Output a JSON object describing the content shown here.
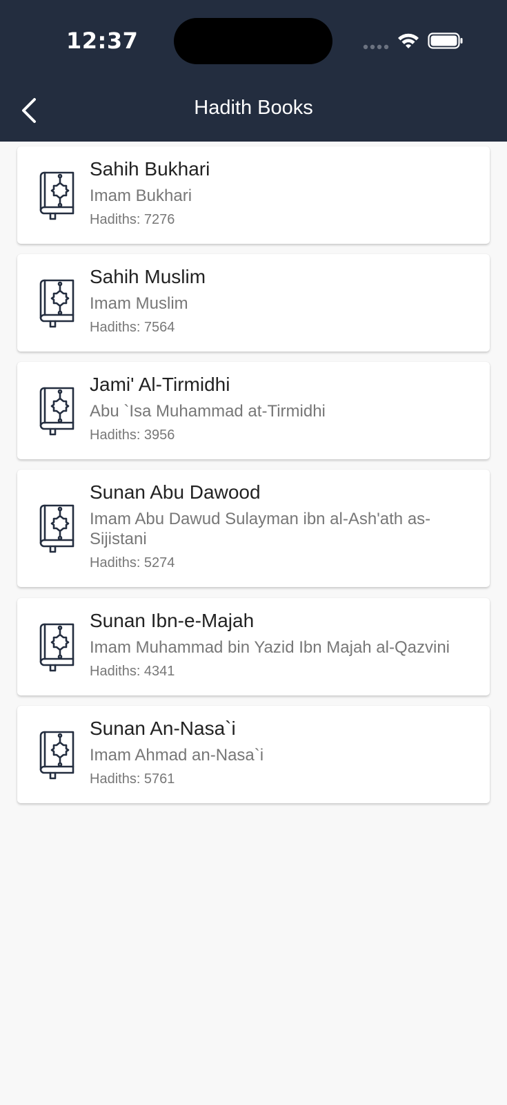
{
  "status_bar": {
    "time": "12:37"
  },
  "nav": {
    "title": "Hadith Books",
    "back_icon": "chevron-left-icon"
  },
  "colors": {
    "header_bg": "#232d3f",
    "page_bg": "#f8f8f8",
    "card_bg": "#ffffff",
    "icon": "#232d3f"
  },
  "books": [
    {
      "title": "Sahih Bukhari",
      "author": "Imam Bukhari",
      "count": "Hadiths: 7276",
      "icon": "book-icon"
    },
    {
      "title": "Sahih Muslim",
      "author": "Imam Muslim",
      "count": "Hadiths: 7564",
      "icon": "book-icon"
    },
    {
      "title": "Jami' Al-Tirmidhi",
      "author": "Abu `Isa Muhammad at-Tirmidhi",
      "count": "Hadiths: 3956",
      "icon": "book-icon"
    },
    {
      "title": "Sunan Abu Dawood",
      "author": "Imam Abu Dawud Sulayman ibn al-Ash'ath as-Sijistani",
      "count": "Hadiths: 5274",
      "icon": "book-icon"
    },
    {
      "title": "Sunan Ibn-e-Majah",
      "author": "Imam Muhammad bin Yazid Ibn Majah al-Qazvini",
      "count": "Hadiths: 4341",
      "icon": "book-icon"
    },
    {
      "title": "Sunan An-Nasa`i",
      "author": "Imam Ahmad an-Nasa`i",
      "count": "Hadiths: 5761",
      "icon": "book-icon"
    }
  ]
}
